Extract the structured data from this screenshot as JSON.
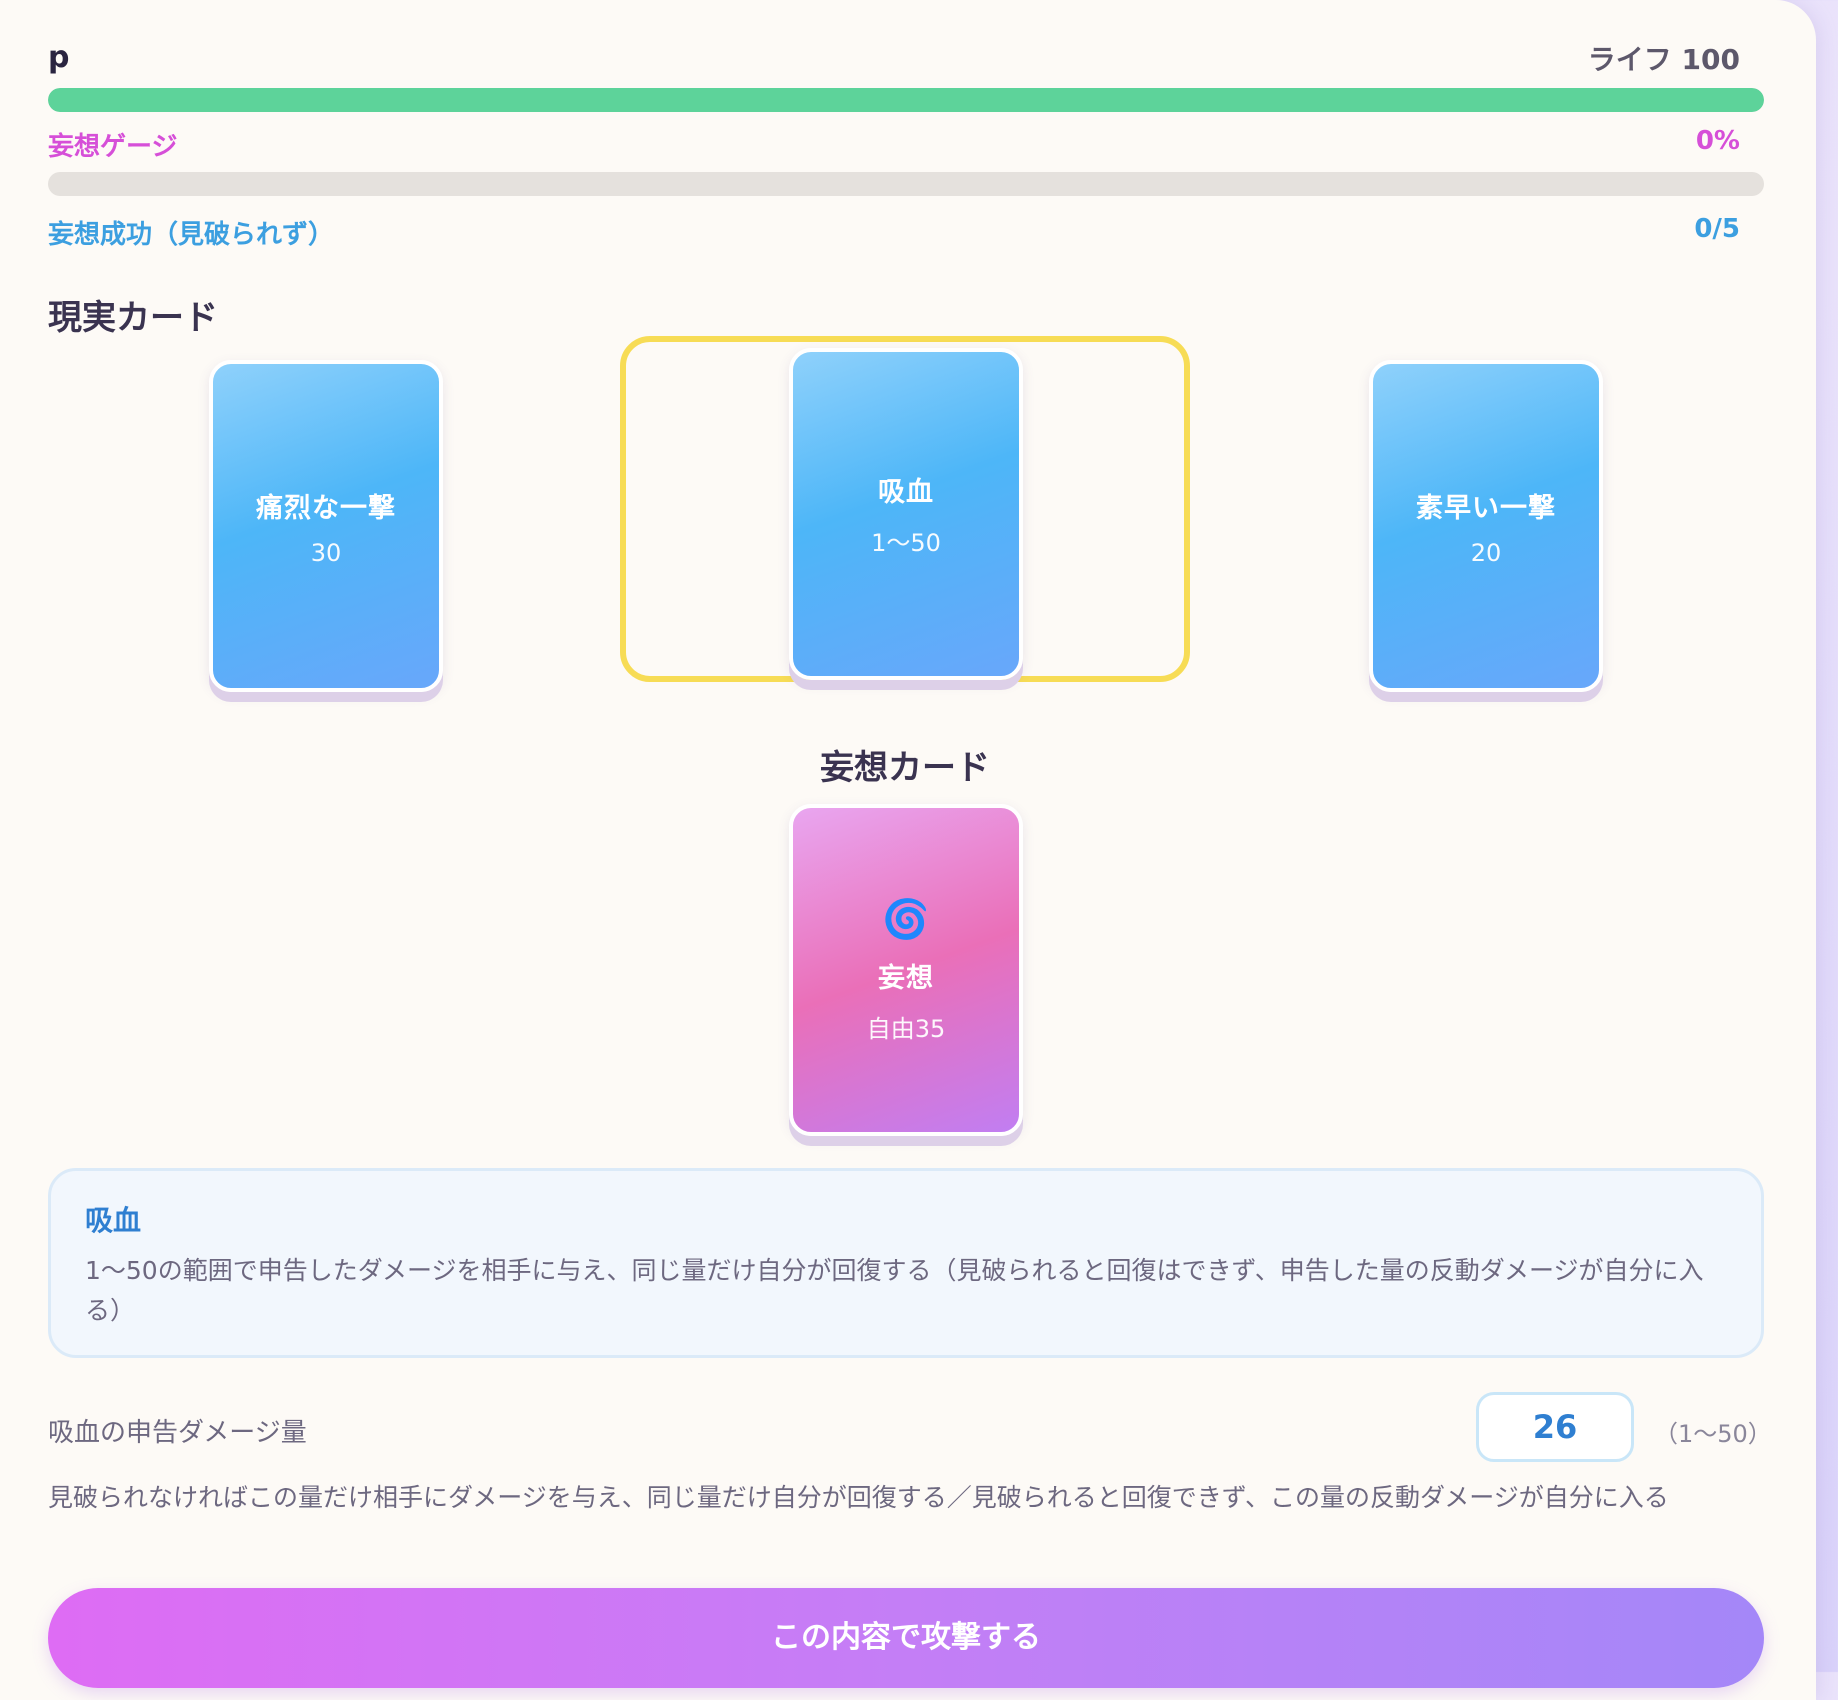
{
  "player": {
    "name": "p",
    "life_label": "ライフ 100",
    "life_fraction": 1.0
  },
  "delusion_gauge": {
    "label": "妄想ゲージ",
    "value": "0%",
    "fraction": 0.0
  },
  "delusion_success": {
    "label": "妄想成功（見破られず）",
    "value": "0/5"
  },
  "reality_section": {
    "title": "現実カード",
    "cards": [
      {
        "name": "痛烈な一撃",
        "value": "30"
      },
      {
        "name": "吸血",
        "value": "1〜50",
        "selected": true
      },
      {
        "name": "素早い一撃",
        "value": "20"
      }
    ]
  },
  "delusion_section": {
    "title": "妄想カード",
    "card": {
      "icon": "🌀",
      "icon_name": "spiral-icon",
      "name": "妄想",
      "value": "自由35"
    }
  },
  "description": {
    "title": "吸血",
    "text": "1〜50の範囲で申告したダメージを相手に与え、同じ量だけ自分が回復する（見破られると回復はできず、申告した量の反動ダメージが自分に入る）"
  },
  "damage_declaration": {
    "label": "吸血の申告ダメージ量",
    "value": "26",
    "range": "（1〜50）",
    "note": "見破られなければこの量だけ相手にダメージを与え、同じ量だけ自分が回復する／見破られると回復できず、この量の反動ダメージが自分に入る"
  },
  "actions": {
    "attack_label": "この内容で攻撃する"
  },
  "colors": {
    "life_bar": "#5dd39a",
    "delusion_accent": "#d64fd8",
    "success_accent": "#3c9fe0",
    "selection_frame": "#f7dc55",
    "reality_card": "#4db6f8",
    "delusion_card": "#ea6fb8"
  }
}
